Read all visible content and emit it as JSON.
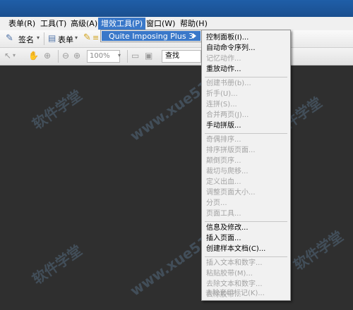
{
  "menubar": {
    "items": [
      {
        "label": "表单(R)"
      },
      {
        "label": "工具(T)"
      },
      {
        "label": "高级(A)"
      },
      {
        "label": "增效工具(P)"
      },
      {
        "label": "窗口(W)"
      },
      {
        "label": "帮助(H)"
      }
    ]
  },
  "toolbar": {
    "sign_label": "签名",
    "form_label": "表单",
    "zoom_value": "100%",
    "search_value": "查找"
  },
  "submenu": {
    "label": "Quite Imposing Plus 3"
  },
  "dropdown": {
    "items": [
      {
        "label": "控制面板(I)...",
        "disabled": false
      },
      {
        "label": "自动命令序列...",
        "disabled": false
      },
      {
        "label": "记忆动作...",
        "disabled": true
      },
      {
        "label": "重放动作...",
        "disabled": false
      },
      {
        "label": "创建书册(b)...",
        "disabled": true
      },
      {
        "label": "折手(U)...",
        "disabled": true
      },
      {
        "label": "连拼(S)...",
        "disabled": true
      },
      {
        "label": "合并两页(J)...",
        "disabled": true
      },
      {
        "label": "手动拼版...",
        "disabled": false
      },
      {
        "label": "奇偶排序...",
        "disabled": true
      },
      {
        "label": "排序拼版页面...",
        "disabled": true
      },
      {
        "label": "颠倒页序...",
        "disabled": true
      },
      {
        "label": "裁切与爬移...",
        "disabled": true
      },
      {
        "label": "定义出血...",
        "disabled": true
      },
      {
        "label": "调整页面大小...",
        "disabled": true
      },
      {
        "label": "分页...",
        "disabled": true
      },
      {
        "label": "页面工具...",
        "disabled": true
      },
      {
        "label": "信息及修改...",
        "disabled": false
      },
      {
        "label": "插入页面...",
        "disabled": false
      },
      {
        "label": "创建样本文档(C)...",
        "disabled": false
      },
      {
        "label": "插入文本和数字...",
        "disabled": true
      },
      {
        "label": "粘贴胶带(M)...",
        "disabled": true
      },
      {
        "label": "去除文本和数字...",
        "disabled": true
      },
      {
        "label": "去除胶带...",
        "disabled": true
      },
      {
        "label": "去除套印标记(K)...",
        "disabled": true
      }
    ]
  },
  "watermarks": [
    "软件学堂",
    "www.xue51.com"
  ]
}
